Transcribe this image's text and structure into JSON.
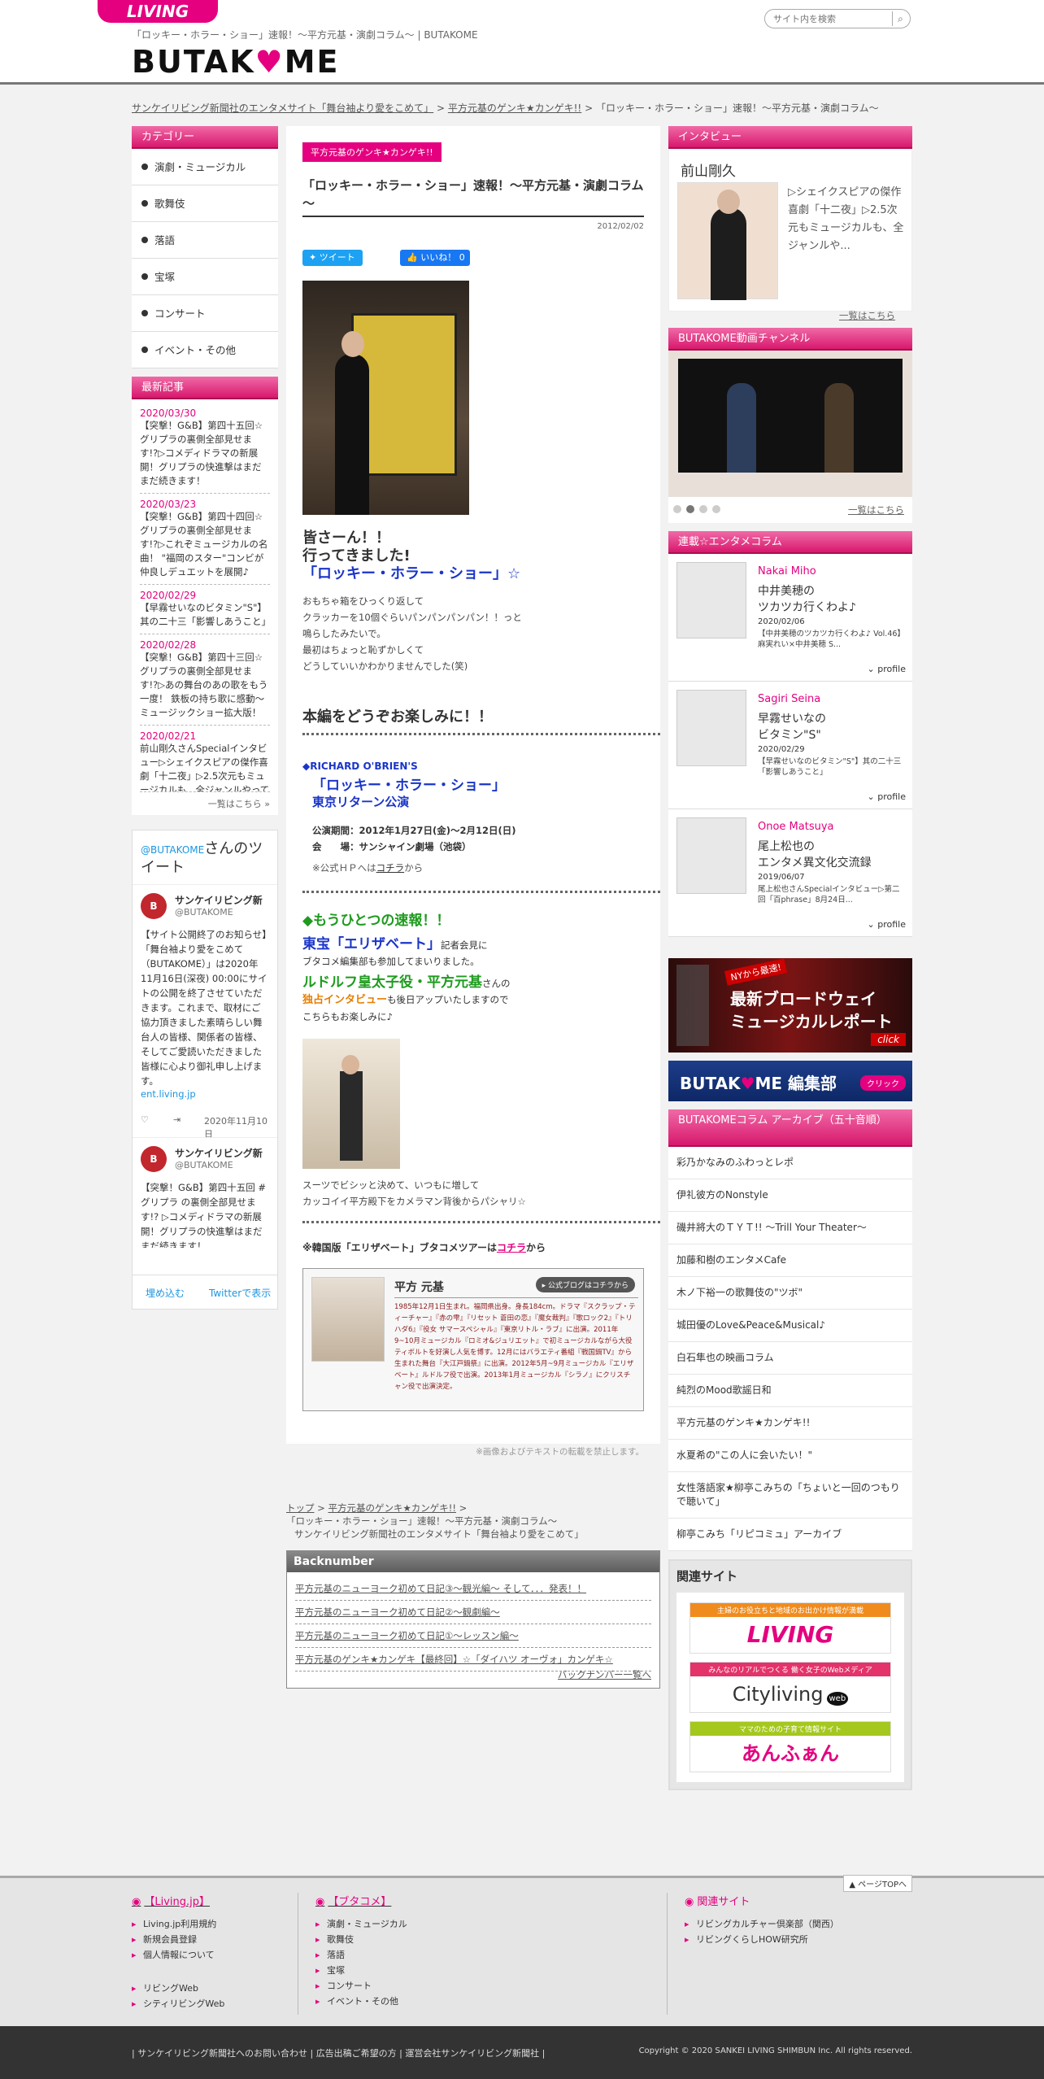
{
  "header": {
    "living_label": "LIVING",
    "tagline": "「ロッキー・ホラー・ショー」速報！～平方元基・演劇コラム～ | BUTAKOME",
    "logo_pre": "BUTAK",
    "logo_post": "ME",
    "search_placeholder": "サイト内を検索"
  },
  "breadcrumb_top": {
    "item1": "サンケイリビング新聞社のエンタメサイト「舞台袖より愛をこめて」",
    "item2": "平方元基のゲンキ★カンゲキ!!",
    "current": "「ロッキー・ホラー・ショー」速報！～平方元基・演劇コラム～",
    "sep": " > "
  },
  "left": {
    "category_heading": "カテゴリー",
    "categories": [
      "演劇・ミュージカル",
      "歌舞伎",
      "落語",
      "宝塚",
      "コンサート",
      "イベント・その他"
    ],
    "news_heading": "最新記事",
    "news": [
      {
        "date": "2020/03/30",
        "text": "【突撃！G&B】第四十五回☆グリプラの裏側全部見せます!?▷コメディドラマの新展開！グリプラの快進撃はまだまだ続きます！"
      },
      {
        "date": "2020/03/23",
        "text": "【突撃！G&B】第四十四回☆グリプラの裏側全部見せます!?▷これぞミュージカルの名曲！ \"福岡のスター\"コンビが仲良しデュエットを展開♪"
      },
      {
        "date": "2020/02/29",
        "text": "【早霧せいなのビタミン\"S\"】其の二十三「影響しあうこと」"
      },
      {
        "date": "2020/02/28",
        "text": "【突撃！G&B】第四十三回☆グリプラの裏側全部見せます!?▷あの舞台のあの歌をもう一度！ 鉄板の持ち歌に感動～ミュージックショー拡大版！"
      },
      {
        "date": "2020/02/21",
        "text": "前山剛久さんSpecialインタビュー▷シェイクスピアの傑作喜劇「十二夜」▷2.5次元もミュージカルも、全ジャンルやってきたことが僕の強み"
      }
    ],
    "news_more": "一覧はこちら »",
    "twitter": {
      "by_pre": "@BUTAKOME",
      "by_post": "さんのツイート",
      "account_name": "サンケイリビング新",
      "handle": "@BUTAKOME",
      "tweet1": "【サイト公開終了のお知らせ】「舞台袖より愛をこめて（BUTAKOME）」は2020年11月16日(深夜) 00:00にサイトの公開を終了させていただきます。これまで、取材にご協力頂きました素晴らしい舞台人の皆様、関係者の皆様、そしてご愛読いただきました皆様に心より御礼申し上げます。",
      "tweet1_link": "ent.living.jp",
      "tweet1_date": "2020年11月10日",
      "tweet2": "【突撃！G&B】第四十五回 #グリプラ の裏側全部見せます!? ▷コメディドラマの新展開！グリプラの快進撃はまだまだ続きます！",
      "embed": "埋め込む",
      "view": "Twitterで表示"
    }
  },
  "main": {
    "category_tag": "平方元基のゲンキ★カンゲキ!!",
    "title": "「ロッキー・ホラー・ショー」速報！～平方元基・演劇コラム～",
    "date": "2012/02/02",
    "tweet_btn": "ツイート",
    "like_btn": "いいね！ 0",
    "lead1": "皆さーん！！",
    "lead2": "行ってきました!",
    "lead3": "「ロッキー・ホラー・ショー」☆",
    "body1": "おもちゃ箱をひっくり返して",
    "body2": "クラッカーを10個ぐらいパンパンパンパン！！っと",
    "body3": "鳴らしたみたいで。",
    "body4": "最初はちょっと恥ずかしくて",
    "body5": "どうしていいかわかりませんでした(笑)",
    "enjoy": "本編をどうぞお楽しみに！！",
    "show_credit": "◆RICHARD O'BRIEN'S",
    "show_title": "「ロッキー・ホラー・ショー」",
    "show_sub": "東京リターン公演",
    "period": "公演期間：2012年1月27日(金)～2月12日(日)",
    "venue": "会　　場：サンシャイン劇場（池袋）",
    "official_pre": "※公式ＨＰへは",
    "official_link": "コチラ",
    "official_post": "から",
    "another": "◆もうひとつの速報！！",
    "elis_title": "東宝「エリザベート」",
    "elis_rest": "記者会見に",
    "elis_line2": "ブタコメ編集部も参加してまいりました。",
    "rudolf": "ルドルフ皇太子役・平方元基",
    "rudolf_post": "さんの",
    "exclusive": "独占インタビュー",
    "excl_post": "も後日アップいたしますので",
    "look": "こちらもお楽しみに♪",
    "caption1": "スーツでビシッと決めて、いつもに増して",
    "caption2": "カッコイイ平方殿下をカメラマン背後からパシャリ☆",
    "korea_pre": "※韓国版「エリザベート」ブタコメツアーは",
    "korea_link": "コチラ",
    "korea_post": "から",
    "profile_name": "平方 元基",
    "profile_blog": "▸ 公式ブログはコチラから",
    "profile_text": "1985年12月1日生まれ。福岡県出身。身長184cm。ドラマ『スクラップ・ティーチャー』『赤の雫』『リセット 蒼田の恋』『魔女裁判』『歌ロック2』『トリハダ6』『役女 サマースペシャル』『東京リトル・ラブ』に出演。2011年9~10月ミュージカル『ロミオ&ジュリエット』で初ミュージカルながら大役ティボルトを好演し人気を博す。12月にはバラエティ番組『戦国鍋TV』から生まれた舞台『大江戸鍋祭』に出演。2012年5月~9月ミュージカル『エリザベート』ルドルフ役で出演。2013年1月ミュージカル『シラノ』にクリスチャン役で出演決定。",
    "copyright_note": "※画像およびテキストの転載を禁止します。"
  },
  "crumb_bottom": {
    "top": "トップ",
    "cat": "平方元基のゲンキ★カンゲキ!!",
    "cur": "「ロッキー・ホラー・ショー」速報！～平方元基・演劇コラム～",
    "site": "サンケイリビング新聞社のエンタメサイト「舞台袖より愛をこめて」",
    "sep": " > "
  },
  "backnumber": {
    "heading": "Backnumber",
    "items": [
      "平方元基のニューヨーク初めて日記③～観光編～ そして．．．発表！！",
      "平方元基のニューヨーク初めて日記②～観劇編～",
      "平方元基のニューヨーク初めて日記①～レッスン編～",
      "平方元基のゲンキ★カンゲキ【最終回】☆「ダイハツ オーヴォ」カンゲキ☆"
    ],
    "more": "バックナンバー一覧へ"
  },
  "right": {
    "interview_heading": "インタビュー",
    "interview_name": "前山剛久",
    "interview_text": "▷シェイクスピアの傑作喜劇「十二夜」▷2.5次元もミュージカルも、全ジャンルや...",
    "interview_more": "一覧はこちら",
    "video_heading": "BUTAKOME動画チャンネル",
    "video_more": "一覧はこちら",
    "column_heading": "連載☆エンタメコラム",
    "columns": [
      {
        "name": "Nakai Miho",
        "title": "中井美穂の\nツカツカ行くわよ♪",
        "date": "2020/02/06",
        "summary": "【中井美穂のツカツカ行くわよ♪ Vol.46】麻実れい×中井美穂 S...",
        "profile": "profile"
      },
      {
        "name": "Sagiri Seina",
        "title": "早霧せいなの\nビタミン\"S\"",
        "date": "2020/02/29",
        "summary": "【早霧せいなのビタミン\"S\"】其の二十三「影響しあうこと」",
        "profile": "profile"
      },
      {
        "name": "Onoe Matsuya",
        "title": "尾上松也の\nエンタメ異文化交流録",
        "date": "2019/06/07",
        "summary": "尾上松也さんSpecialインタビュー▷第二回「百phrase」8月24日...",
        "profile": "profile"
      }
    ],
    "banner1_small": "NYから最速!",
    "banner1_line1": "最新ブロードウェイ",
    "banner1_line2": "ミュージカルレポート",
    "banner1_click": "click",
    "banner2_pre": "BUTAK",
    "banner2_post": "ME 編集部",
    "banner2_click": "クリック",
    "archive_heading": "BUTAKOMEコラム アーカイブ（五十音順）",
    "archive": [
      "彩乃かなみのふわっとレポ",
      "伊礼彼方のNonstyle",
      "磯井將大のＴＹＴ!! 〜Trill Your Theater〜",
      "加藤和樹のエンタメCafe",
      "木ノ下裕一の歌舞伎の\"ツボ\"",
      "城田優のLove&Peace&Musical♪",
      "白石隼也の映画コラム",
      "純烈のMood歌謡日和",
      "平方元基のゲンキ★カンゲキ!!",
      "水夏希の\"この人に会いたい！\"",
      "女性落語家★柳亭こみちの「ちょいと一回のつもりで聴いて」",
      "柳亭こみち「リピコミュ」アーカイブ"
    ],
    "related_heading": "関連サイト",
    "rel1_top": "主婦のお役立ちと地域のお出かけ情報が満載",
    "rel1_logo": "LIVING",
    "rel2_top": "みんなのリアルでつくる 働く女子のWebメディア",
    "rel2_logo": "Cityliving",
    "rel2_web": "web",
    "rel3_top": "ママのための子育て情報サイト",
    "rel3_logo": "あんふぁん"
  },
  "footer": {
    "pagetop": "▲ ページTOPへ",
    "col1_heading": "【Living.jp】",
    "col1_items": [
      "Living.jp利用規約",
      "新規会員登録",
      "個人情報について",
      "リビングWeb",
      "シティリビングWeb"
    ],
    "col2_heading": "【ブタコメ】",
    "col2_items": [
      "演劇・ミュージカル",
      "歌舞伎",
      "落語",
      "宝塚",
      "コンサート",
      "イベント・その他"
    ],
    "col3_heading": "関連サイト",
    "col3_items": [
      "リビングカルチャー倶楽部（関西）",
      "リビングくらしHOW研究所"
    ],
    "bottom_links": [
      "サンケイリビング新聞社へのお問い合わせ",
      "広告出稿ご希望の方",
      "運営会社サンケイリビング新聞社"
    ],
    "copyright": "Copyright © 2020 SANKEI LIVING SHIMBUN Inc. All rights reserved."
  }
}
